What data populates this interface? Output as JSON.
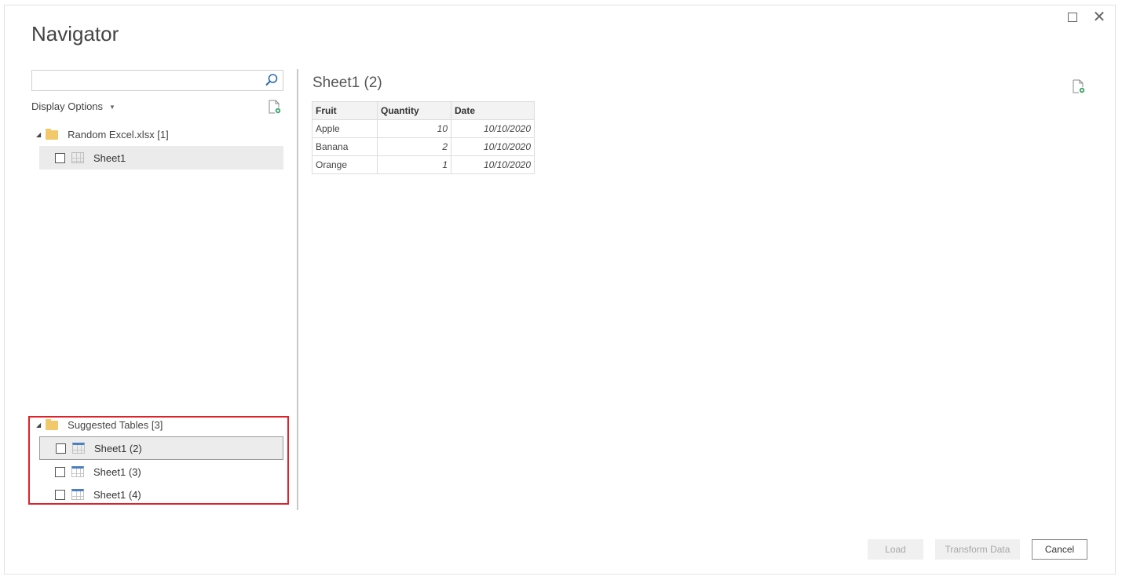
{
  "window": {
    "title": "Navigator",
    "maximize_icon": "maximize-icon",
    "close_icon": "close-icon",
    "close_glyph": "✕"
  },
  "left_pane": {
    "search": {
      "value": "",
      "placeholder": "",
      "icon": "search-icon"
    },
    "display_options_label": "Display Options",
    "display_options_caret": "▼",
    "refresh_icon": "refresh-icon",
    "groups": [
      {
        "label": "Random Excel.xlsx [1]",
        "expanded_glyph": "◢",
        "items": [
          {
            "label": "Sheet1",
            "checked": false,
            "icon": "sheet-icon",
            "state": "hover"
          }
        ]
      },
      {
        "label": "Suggested Tables [3]",
        "expanded_glyph": "◢",
        "highlighted": true,
        "items": [
          {
            "label": "Sheet1 (2)",
            "checked": false,
            "icon": "table-icon",
            "state": "selected"
          },
          {
            "label": "Sheet1 (3)",
            "checked": false,
            "icon": "table-icon",
            "state": ""
          },
          {
            "label": "Sheet1 (4)",
            "checked": false,
            "icon": "table-icon",
            "state": ""
          }
        ]
      }
    ]
  },
  "preview": {
    "title": "Sheet1 (2)",
    "refresh_icon": "refresh-icon",
    "columns": [
      "Fruit",
      "Quantity",
      "Date"
    ],
    "rows": [
      [
        "Apple",
        "10",
        "10/10/2020"
      ],
      [
        "Banana",
        "2",
        "10/10/2020"
      ],
      [
        "Orange",
        "1",
        "10/10/2020"
      ]
    ]
  },
  "footer": {
    "load_label": "Load",
    "transform_label": "Transform Data",
    "cancel_label": "Cancel"
  },
  "colors": {
    "highlight_border": "#e0202a",
    "folder": "#f1c96b",
    "table_icon_accent": "#4a7fc1",
    "search_icon": "#2b6cb0",
    "refresh_accent": "#3aa36b"
  }
}
